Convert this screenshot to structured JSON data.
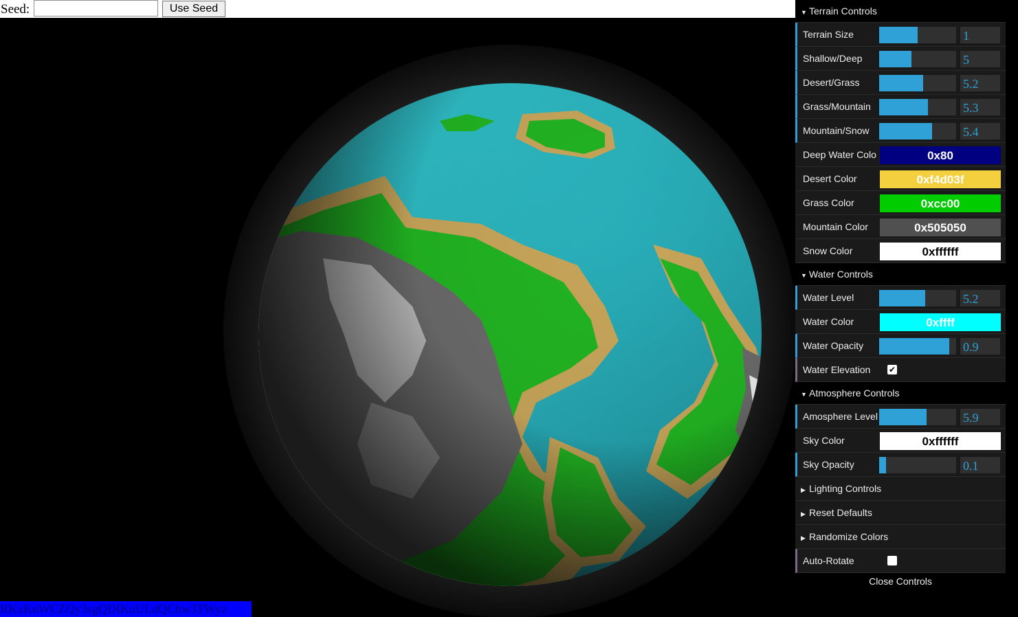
{
  "seed_bar": {
    "label": "Seed:",
    "input_value": "",
    "button_label": "Use Seed"
  },
  "seed_text": "RKxKuWCZQy3sgQDIKuULdQChw3TWyz",
  "gui": {
    "terrain": {
      "title": "Terrain Controls",
      "sliders": [
        {
          "label": "Terrain Size",
          "value": "1",
          "fraction": 0.5
        },
        {
          "label": "Shallow/Deep",
          "value": "5",
          "fraction": 0.42
        },
        {
          "label": "Desert/Grass",
          "value": "5.2",
          "fraction": 0.57
        },
        {
          "label": "Grass/Mountain",
          "value": "5.3",
          "fraction": 0.63
        },
        {
          "label": "Mountain/Snow",
          "value": "5.4",
          "fraction": 0.69
        }
      ],
      "colors": [
        {
          "label": "Deep Water Colo",
          "value": "0x80",
          "bg": "#000080",
          "fg": "#ffffff"
        },
        {
          "label": "Desert Color",
          "value": "0xf4d03f",
          "bg": "#f4d03f",
          "fg": "#ffffff"
        },
        {
          "label": "Grass Color",
          "value": "0xcc00",
          "bg": "#00cc00",
          "fg": "#ffffff"
        },
        {
          "label": "Mountain Color",
          "value": "0x505050",
          "bg": "#505050",
          "fg": "#ffffff"
        },
        {
          "label": "Snow Color",
          "value": "0xffffff",
          "bg": "#ffffff",
          "fg": "#000000"
        }
      ]
    },
    "water": {
      "title": "Water Controls",
      "level": {
        "label": "Water Level",
        "value": "5.2",
        "fraction": 0.6
      },
      "color": {
        "label": "Water Color",
        "value": "0xffff",
        "bg": "#00ffff",
        "fg": "#ffffff"
      },
      "opacity": {
        "label": "Water Opacity",
        "value": "0.9",
        "fraction": 0.91
      },
      "elevation": {
        "label": "Water Elevation",
        "checked": true
      }
    },
    "atmosphere": {
      "title": "Atmosphere Controls",
      "level": {
        "label": "Amosphere Level",
        "value": "5.9",
        "fraction": 0.62
      },
      "sky_color": {
        "label": "Sky Color",
        "value": "0xffffff",
        "bg": "#ffffff",
        "fg": "#000000"
      },
      "sky_opacity": {
        "label": "Sky Opacity",
        "value": "0.1",
        "fraction": 0.09
      }
    },
    "lighting_title": "Lighting Controls",
    "reset_label": "Reset Defaults",
    "randomize_label": "Randomize Colors",
    "auto_rotate": {
      "label": "Auto-Rotate",
      "checked": false
    },
    "close_label": "Close Controls"
  },
  "colors": {
    "accent": "#2fa1d6",
    "panel_bg": "#1a1a1a",
    "ocean": "#2fb8c4",
    "grass": "#22b422",
    "desert": "#c8a65a",
    "mountain": "#6a6a6a"
  }
}
